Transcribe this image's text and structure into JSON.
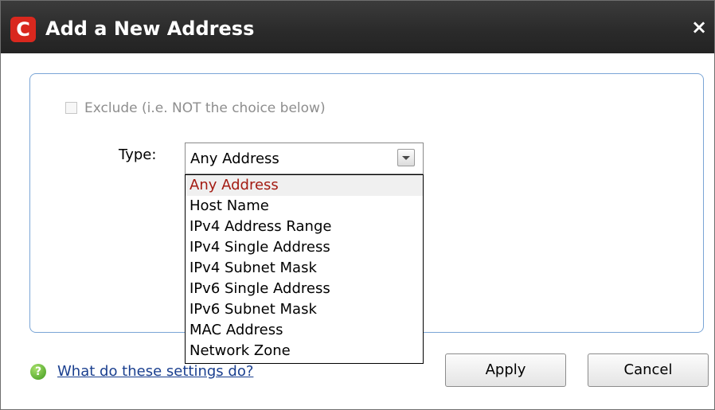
{
  "window": {
    "title": "Add a New Address",
    "logo_letter": "C",
    "close_glyph": "×",
    "title_bar_color": "#2a2a2a",
    "logo_color": "#d9281e"
  },
  "form": {
    "exclude_label": "Exclude (i.e. NOT the choice below)",
    "exclude_checked": false,
    "exclude_enabled": false,
    "type_label": "Type:",
    "type_value": "Any Address"
  },
  "dropdown": {
    "selected_index": 0,
    "options": [
      "Any Address",
      "Host Name",
      "IPv4 Address Range",
      "IPv4 Single Address",
      "IPv4 Subnet Mask",
      "IPv6 Single Address",
      "IPv6 Subnet Mask",
      "MAC Address",
      "Network Zone"
    ]
  },
  "footer": {
    "help_icon": "help-icon",
    "help_glyph": "?",
    "help_link": "What do these settings do?",
    "apply_label": "Apply",
    "cancel_label": "Cancel"
  }
}
